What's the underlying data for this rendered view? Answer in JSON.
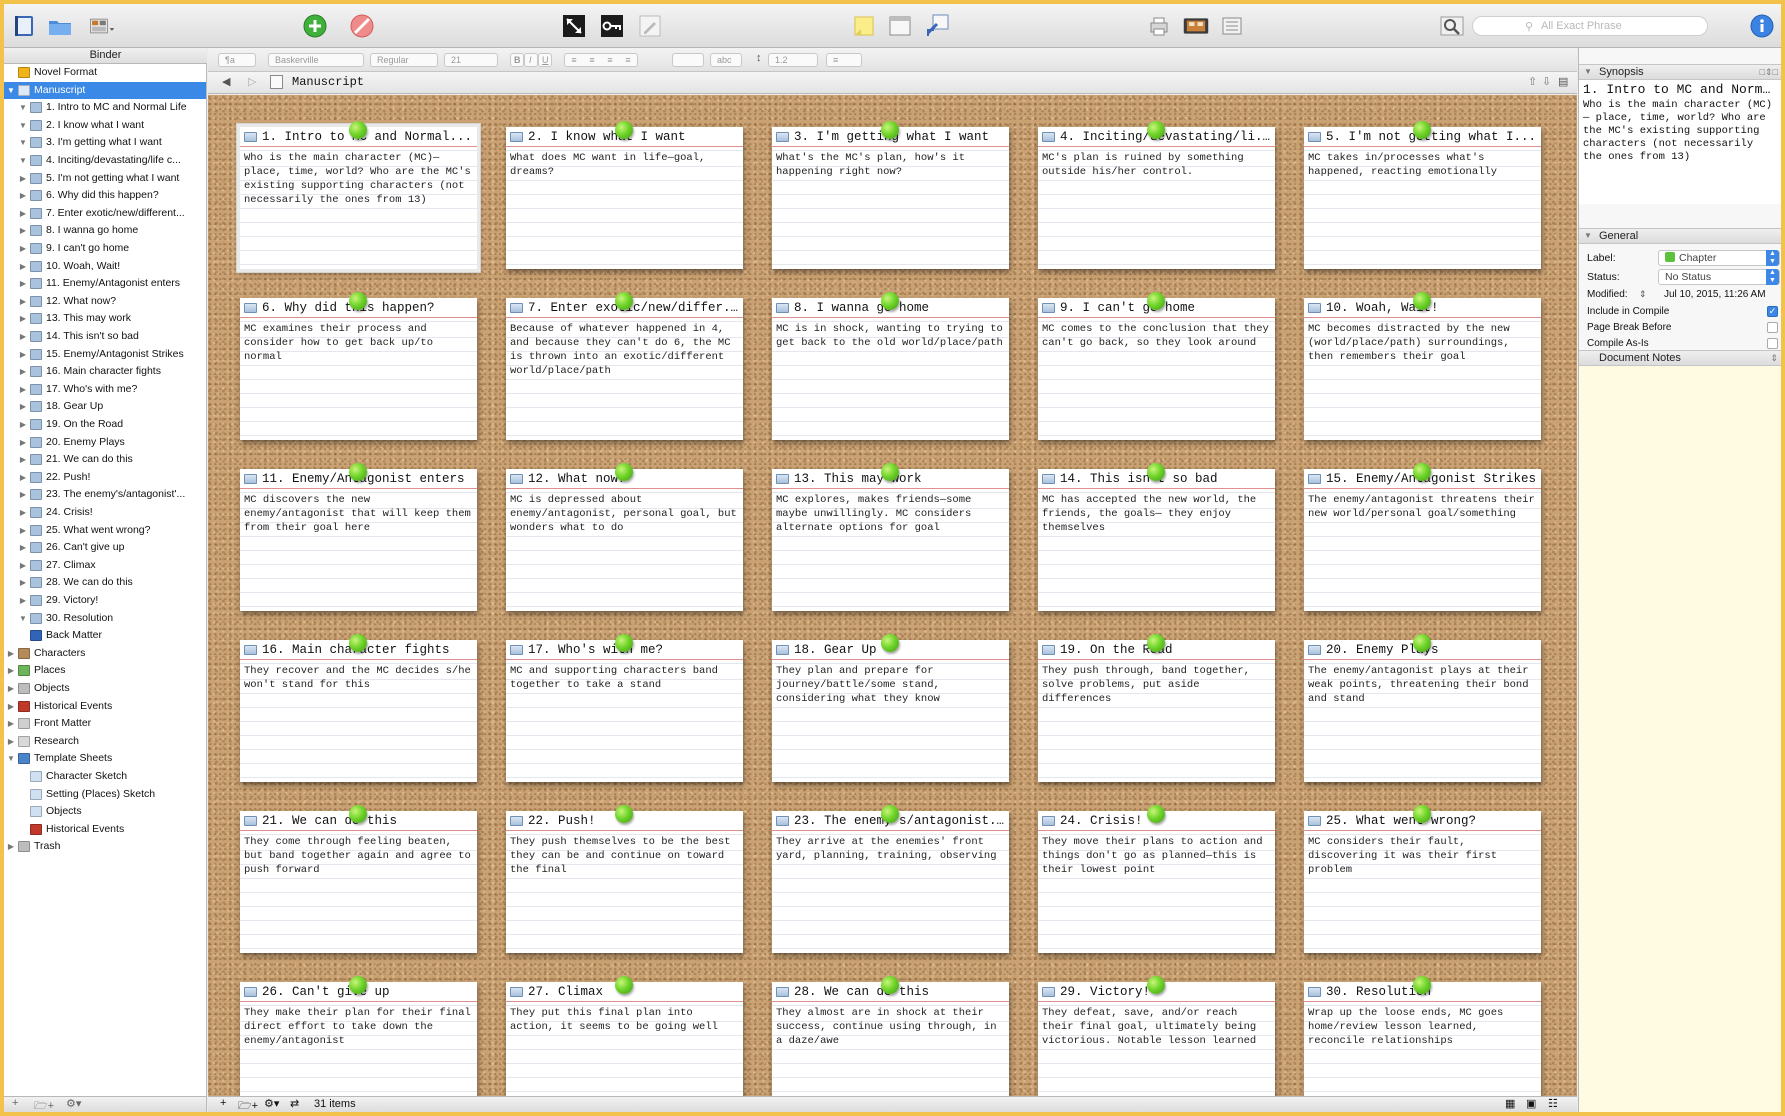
{
  "toolbar": {
    "search_placeholder": "All Exact Phrase"
  },
  "binder": {
    "header": "Binder",
    "items": [
      {
        "label": "Novel Format",
        "level": 0,
        "expander": "",
        "icon": "warning-icon",
        "color": "#f0b419"
      },
      {
        "label": "Manuscript",
        "level": 0,
        "expander": "▼",
        "icon": "manuscript-icon",
        "color": "#dbe8f6",
        "selected": true
      },
      {
        "label": "1. Intro to MC and Normal Life",
        "level": 1,
        "expander": "▼",
        "icon": "folder-icon",
        "color": "#a9c3df"
      },
      {
        "label": "2. I know what I want",
        "level": 1,
        "expander": "▼",
        "icon": "folder-icon",
        "color": "#a9c3df"
      },
      {
        "label": "3. I'm getting what I want",
        "level": 1,
        "expander": "▼",
        "icon": "folder-icon",
        "color": "#a9c3df"
      },
      {
        "label": "4. Inciting/devastating/life c...",
        "level": 1,
        "expander": "▼",
        "icon": "folder-icon",
        "color": "#a9c3df"
      },
      {
        "label": "5. I'm not getting what I want",
        "level": 1,
        "expander": "▶",
        "icon": "folder-icon",
        "color": "#a9c3df"
      },
      {
        "label": "6. Why did this happen?",
        "level": 1,
        "expander": "▶",
        "icon": "folder-icon",
        "color": "#a9c3df"
      },
      {
        "label": "7. Enter exotic/new/different...",
        "level": 1,
        "expander": "▶",
        "icon": "folder-icon",
        "color": "#a9c3df"
      },
      {
        "label": "8. I wanna go home",
        "level": 1,
        "expander": "▶",
        "icon": "folder-icon",
        "color": "#a9c3df"
      },
      {
        "label": "9. I can't go home",
        "level": 1,
        "expander": "▶",
        "icon": "folder-icon",
        "color": "#a9c3df"
      },
      {
        "label": "10. Woah, Wait!",
        "level": 1,
        "expander": "▶",
        "icon": "folder-icon",
        "color": "#a9c3df"
      },
      {
        "label": "11. Enemy/Antagonist enters",
        "level": 1,
        "expander": "▶",
        "icon": "folder-icon",
        "color": "#a9c3df"
      },
      {
        "label": "12. What now?",
        "level": 1,
        "expander": "▶",
        "icon": "folder-icon",
        "color": "#a9c3df"
      },
      {
        "label": "13. This may work",
        "level": 1,
        "expander": "▶",
        "icon": "folder-icon",
        "color": "#a9c3df"
      },
      {
        "label": "14. This isn't so bad",
        "level": 1,
        "expander": "▶",
        "icon": "folder-icon",
        "color": "#a9c3df"
      },
      {
        "label": "15. Enemy/Antagonist Strikes",
        "level": 1,
        "expander": "▶",
        "icon": "folder-icon",
        "color": "#a9c3df"
      },
      {
        "label": "16. Main character fights",
        "level": 1,
        "expander": "▶",
        "icon": "folder-icon",
        "color": "#a9c3df"
      },
      {
        "label": "17. Who's with me?",
        "level": 1,
        "expander": "▶",
        "icon": "folder-icon",
        "color": "#a9c3df"
      },
      {
        "label": "18. Gear Up",
        "level": 1,
        "expander": "▶",
        "icon": "folder-icon",
        "color": "#a9c3df"
      },
      {
        "label": "19. On the Road",
        "level": 1,
        "expander": "▶",
        "icon": "folder-icon",
        "color": "#a9c3df"
      },
      {
        "label": "20. Enemy Plays",
        "level": 1,
        "expander": "▶",
        "icon": "folder-icon",
        "color": "#a9c3df"
      },
      {
        "label": "21. We can do this",
        "level": 1,
        "expander": "▶",
        "icon": "folder-icon",
        "color": "#a9c3df"
      },
      {
        "label": "22. Push!",
        "level": 1,
        "expander": "▶",
        "icon": "folder-icon",
        "color": "#a9c3df"
      },
      {
        "label": "23. The enemy's/antagonist'...",
        "level": 1,
        "expander": "▶",
        "icon": "folder-icon",
        "color": "#a9c3df"
      },
      {
        "label": "24. Crisis!",
        "level": 1,
        "expander": "▶",
        "icon": "folder-icon",
        "color": "#a9c3df"
      },
      {
        "label": "25. What went wrong?",
        "level": 1,
        "expander": "▶",
        "icon": "folder-icon",
        "color": "#a9c3df"
      },
      {
        "label": "26. Can't give up",
        "level": 1,
        "expander": "▶",
        "icon": "folder-icon",
        "color": "#a9c3df"
      },
      {
        "label": "27. Climax",
        "level": 1,
        "expander": "▶",
        "icon": "folder-icon",
        "color": "#a9c3df"
      },
      {
        "label": "28. We can do this",
        "level": 1,
        "expander": "▶",
        "icon": "folder-icon",
        "color": "#a9c3df"
      },
      {
        "label": "29. Victory!",
        "level": 1,
        "expander": "▶",
        "icon": "folder-icon",
        "color": "#a9c3df"
      },
      {
        "label": "30. Resolution",
        "level": 1,
        "expander": "▼",
        "icon": "folder-icon",
        "color": "#a9c3df"
      },
      {
        "label": "Back Matter",
        "level": 1,
        "expander": "",
        "icon": "book-icon",
        "color": "#2f64b8"
      },
      {
        "label": "Characters",
        "level": 0,
        "expander": "▶",
        "icon": "characters-icon",
        "color": "#b48a5a"
      },
      {
        "label": "Places",
        "level": 0,
        "expander": "▶",
        "icon": "places-icon",
        "color": "#6db55a"
      },
      {
        "label": "Objects",
        "level": 0,
        "expander": "▶",
        "icon": "objects-icon",
        "color": "#bdbdbd"
      },
      {
        "label": "Historical Events",
        "level": 0,
        "expander": "▶",
        "icon": "history-icon",
        "color": "#c0392b"
      },
      {
        "label": "Front Matter",
        "level": 0,
        "expander": "▶",
        "icon": "front-matter-icon",
        "color": "#cfcfcf"
      },
      {
        "label": "Research",
        "level": 0,
        "expander": "▶",
        "icon": "research-icon",
        "color": "#d8d8d8"
      },
      {
        "label": "Template Sheets",
        "level": 0,
        "expander": "▼",
        "icon": "template-icon",
        "color": "#4b83c9"
      },
      {
        "label": "Character Sketch",
        "level": 1,
        "expander": "",
        "icon": "sheet-icon",
        "color": "#cfe0f2"
      },
      {
        "label": "Setting (Places) Sketch",
        "level": 1,
        "expander": "",
        "icon": "sheet-icon",
        "color": "#cfe0f2"
      },
      {
        "label": "Objects",
        "level": 1,
        "expander": "",
        "icon": "sheet-icon",
        "color": "#cfe0f2"
      },
      {
        "label": "Historical Events",
        "level": 1,
        "expander": "",
        "icon": "sheet-icon",
        "color": "#c0392b"
      },
      {
        "label": "Trash",
        "level": 0,
        "expander": "▶",
        "icon": "trash-icon",
        "color": "#bdbdbd"
      }
    ]
  },
  "format_bar": {
    "style": "¶a",
    "font": "Baskerville",
    "weight": "Regular",
    "size": "21",
    "bold": "B",
    "italic": "I",
    "underline": "U",
    "highlight": "abc",
    "line_spacing": "1.2"
  },
  "header": {
    "title": "Manuscript"
  },
  "cards": [
    {
      "title": "1. Intro to MC and Normal...",
      "synopsis": "Who is the main character (MC)—place, time, world? Who are the MC's existing supporting characters (not necessarily the ones from 13)",
      "selected": true
    },
    {
      "title": "2. I know what I want",
      "synopsis": "What does MC want in life—goal, dreams?"
    },
    {
      "title": "3. I'm getting what I want",
      "synopsis": "What's the MC's plan, how's it happening right now?"
    },
    {
      "title": "4. Inciting/devastating/li...",
      "synopsis": "MC's plan is ruined by something outside his/her control."
    },
    {
      "title": "5. I'm not getting what I...",
      "synopsis": "MC takes in/processes what's happened, reacting emotionally"
    },
    {
      "title": "6. Why did this happen?",
      "synopsis": "MC examines their process and consider how to get back up/to normal"
    },
    {
      "title": "7. Enter exotic/new/differ...",
      "synopsis": "Because of whatever happened in 4, and because they can't do 6, the MC is thrown into an exotic/different world/place/path"
    },
    {
      "title": "8. I wanna go home",
      "synopsis": "MC is in shock, wanting to trying to get back to the old world/place/path"
    },
    {
      "title": "9. I can't go home",
      "synopsis": "MC comes to the conclusion that they can't go back, so they look around"
    },
    {
      "title": "10. Woah, Wait!",
      "synopsis": "MC becomes distracted by the new (world/place/path) surroundings, then remembers their goal"
    },
    {
      "title": "11. Enemy/Antagonist enters",
      "synopsis": "MC discovers the new enemy/antagonist that will keep them from their goal here"
    },
    {
      "title": "12. What now?",
      "synopsis": "MC is depressed about enemy/antagonist, personal goal, but wonders what to do"
    },
    {
      "title": "13. This may work",
      "synopsis": "MC explores, makes friends—some maybe unwillingly. MC considers alternate options for goal"
    },
    {
      "title": "14. This isn't so bad",
      "synopsis": "MC has accepted the new world, the friends, the goals— they enjoy themselves"
    },
    {
      "title": "15. Enemy/Antagonist Strikes",
      "synopsis": "The enemy/antagonist threatens their new world/personal goal/something"
    },
    {
      "title": "16. Main character fights",
      "synopsis": "They recover and the MC decides s/he won't stand for this"
    },
    {
      "title": "17. Who's with me?",
      "synopsis": "MC and supporting characters band together to take a stand"
    },
    {
      "title": "18. Gear Up",
      "synopsis": "They plan and prepare for journey/battle/some stand, considering what they know"
    },
    {
      "title": "19. On the Road",
      "synopsis": "They push through, band together, solve problems, put aside differences"
    },
    {
      "title": "20. Enemy Plays",
      "synopsis": "The enemy/antagonist plays at their weak points, threatening their bond and stand"
    },
    {
      "title": "21. We can do this",
      "synopsis": "They come through feeling beaten, but band together again and agree to push forward"
    },
    {
      "title": "22. Push!",
      "synopsis": "They push themselves to be the best they can be and continue on toward the final"
    },
    {
      "title": "23. The enemy's/antagonist...",
      "synopsis": "They arrive at the enemies' front yard, planning, training, observing"
    },
    {
      "title": "24. Crisis!",
      "synopsis": "They move their plans to action and things don't go as planned—this is their lowest point"
    },
    {
      "title": "25. What went wrong?",
      "synopsis": "MC considers their fault, discovering it was their first problem"
    },
    {
      "title": "26. Can't give up",
      "synopsis": "They make their plan for their final direct effort to take down the enemy/antagonist"
    },
    {
      "title": "27. Climax",
      "synopsis": "They put this final plan into action, it seems to be going well"
    },
    {
      "title": "28. We can do this",
      "synopsis": "They almost are in shock at their success, continue using through, in a daze/awe"
    },
    {
      "title": "29. Victory!",
      "synopsis": "They defeat, save, and/or reach their final goal, ultimately being victorious. Notable lesson learned"
    },
    {
      "title": "30. Resolution",
      "synopsis": "Wrap up the loose ends, MC goes home/review lesson learned, reconcile relationships"
    }
  ],
  "status_bar": {
    "item_count": "31 items"
  },
  "inspector": {
    "synopsis_header": "Synopsis",
    "synopsis_title": "1. Intro to MC and Norma...",
    "synopsis_text": "Who is the main character (MC)— place, time, world? Who are the MC's existing supporting characters (not necessarily the ones from 13)",
    "general_header": "General",
    "label_caption": "Label:",
    "label_value": "Chapter",
    "label_color": "#5cc23c",
    "status_caption": "Status:",
    "status_value": "No Status",
    "modified_caption": "Modified:",
    "modified_value": "Jul 10, 2015, 11:26 AM",
    "include_caption": "Include in Compile",
    "include_checked": true,
    "pagebreak_caption": "Page Break Before",
    "compile_caption": "Compile As-Is",
    "notes_header": "Document Notes"
  }
}
